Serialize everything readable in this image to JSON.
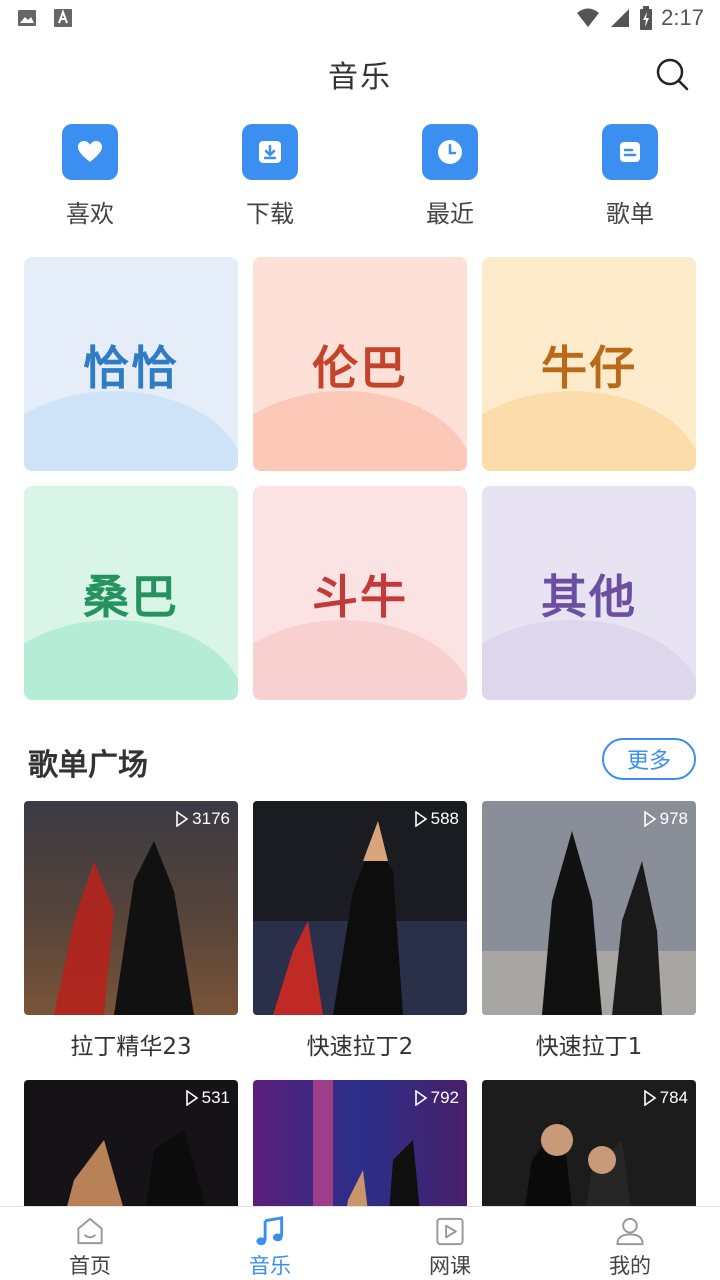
{
  "status": {
    "time": "2:17"
  },
  "header": {
    "title": "音乐"
  },
  "quick": [
    {
      "label": "喜欢",
      "icon": "heart-icon"
    },
    {
      "label": "下载",
      "icon": "download-icon"
    },
    {
      "label": "最近",
      "icon": "clock-icon"
    },
    {
      "label": "歌单",
      "icon": "playlist-icon"
    }
  ],
  "categories": [
    {
      "label": "恰恰",
      "bg": "#e5eef8",
      "blob": "#cfe3f8",
      "color": "#2f7bc4"
    },
    {
      "label": "伦巴",
      "bg": "#fde0d8",
      "blob": "#fcc8b8",
      "color": "#c4432a"
    },
    {
      "label": "牛仔",
      "bg": "#fdebcb",
      "blob": "#fcdcaa",
      "color": "#b8691a"
    },
    {
      "label": "桑巴",
      "bg": "#d8f5e8",
      "blob": "#b5ecd6",
      "color": "#259260"
    },
    {
      "label": "斗牛",
      "bg": "#fbe3e3",
      "blob": "#f8d0cf",
      "color": "#c23a3a"
    },
    {
      "label": "其他",
      "bg": "#e8e3f3",
      "blob": "#ddd6ec",
      "color": "#6c4fa0"
    }
  ],
  "section": {
    "title": "歌单广场",
    "more": "更多"
  },
  "playlists": [
    {
      "name": "拉丁精华23",
      "count": "3176"
    },
    {
      "name": "快速拉丁2",
      "count": "588"
    },
    {
      "name": "快速拉丁1",
      "count": "978"
    },
    {
      "name": "",
      "count": "531"
    },
    {
      "name": "",
      "count": "792"
    },
    {
      "name": "",
      "count": "784"
    }
  ],
  "nav": [
    {
      "label": "首页",
      "icon": "home-icon"
    },
    {
      "label": "音乐",
      "icon": "music-note-icon"
    },
    {
      "label": "网课",
      "icon": "video-course-icon"
    },
    {
      "label": "我的",
      "icon": "profile-icon"
    }
  ],
  "colors": {
    "accent": "#3a8ff0"
  }
}
